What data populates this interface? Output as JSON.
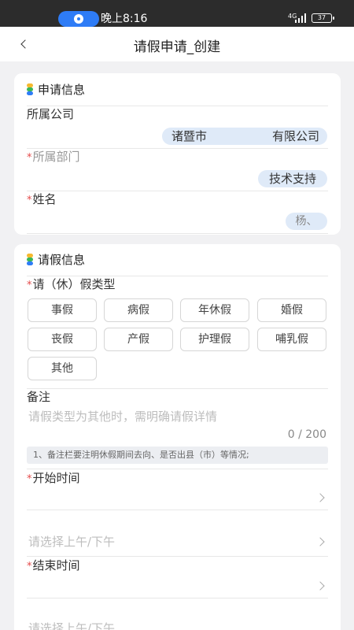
{
  "status_bar": {
    "time": "晚上8:16",
    "network": "4G",
    "battery": "37",
    "accent_color": "#2e7cf6"
  },
  "nav": {
    "back_icon": "chevron-left-icon",
    "title": "请假申请_创建"
  },
  "apply_info": {
    "section_title": "申请信息",
    "company_label": "所属公司",
    "company_value_left": "诸暨市",
    "company_value_right": "有限公司",
    "department_label": "所属部门",
    "department_value": "技术支持",
    "name_label": "姓名",
    "name_value": "杨、"
  },
  "leave_info": {
    "section_title": "请假信息",
    "type_label": "请（休）假类型",
    "types": [
      "事假",
      "病假",
      "年休假",
      "婚假",
      "丧假",
      "产假",
      "护理假",
      "哺乳假",
      "其他"
    ],
    "remark_label": "备注",
    "remark_placeholder": "请假类型为其他时，需明确请假详情",
    "remark_counter": "0 / 200",
    "notice": "1、备注栏要注明休假期间去向、是否出县（市）等情况;",
    "start_label": "开始时间",
    "start_period_placeholder": "请选择上午/下午",
    "end_label": "结束时间",
    "end_period_placeholder": "请选择上午/下午"
  },
  "required_mark": "*"
}
